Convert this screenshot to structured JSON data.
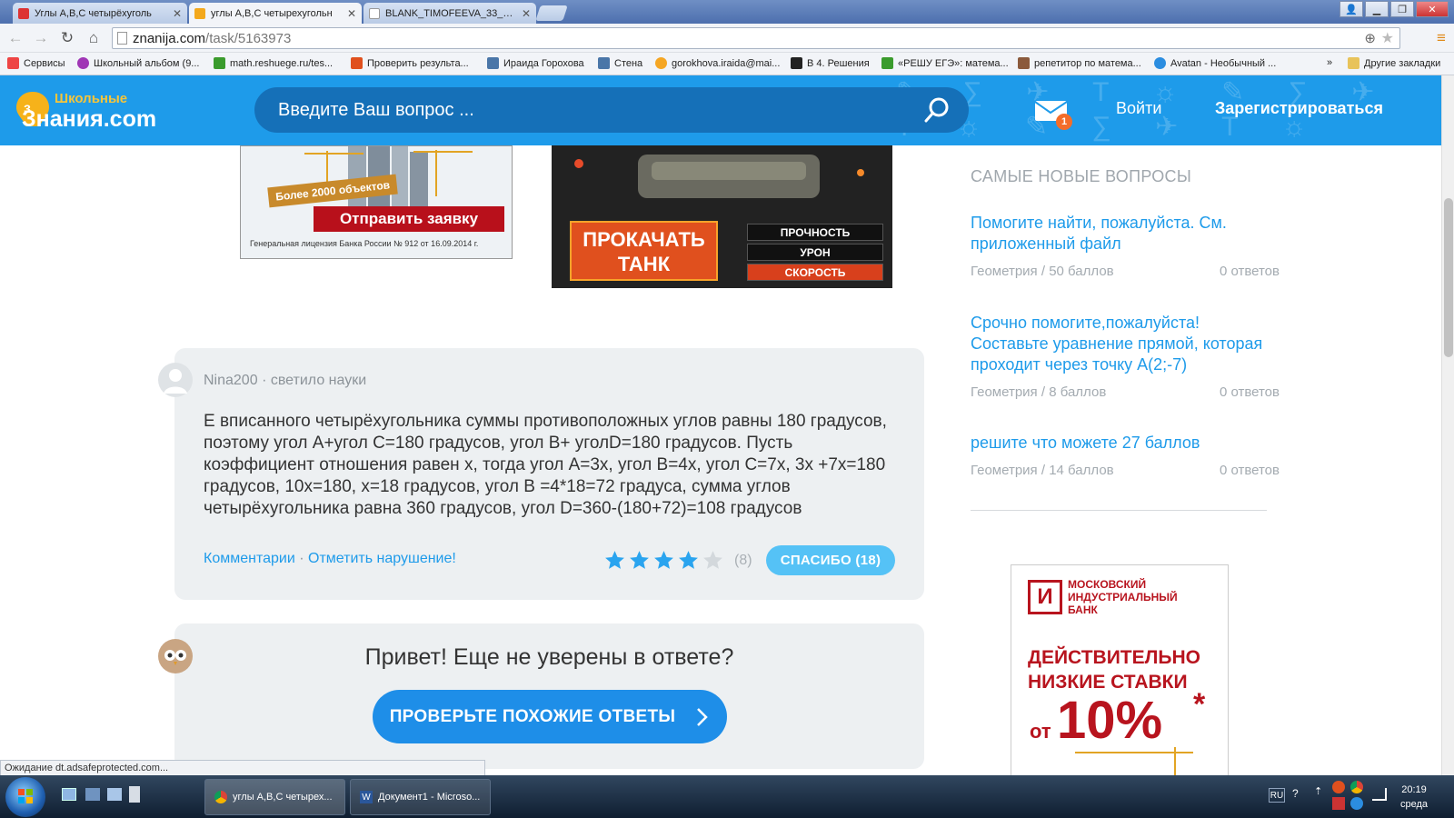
{
  "browser": {
    "tabs": [
      {
        "label": "Углы A,B,C четырёхуголь",
        "color": "#d33",
        "active": false
      },
      {
        "label": "углы А,В,С четырехугольн",
        "color": "#f3a81c",
        "active": true
      },
      {
        "label": "BLANK_TIMOFEEVA_33___3",
        "color": "#888",
        "active": false
      }
    ],
    "url_host": "znanija.com",
    "url_path": "/task/5163973",
    "bookmarks": [
      {
        "label": "Сервисы",
        "color": "#e44"
      },
      {
        "label": "Школьный альбом (9...",
        "color": "#a036b5"
      },
      {
        "label": "math.reshuege.ru/tes...",
        "color": "#3a9b2d"
      },
      {
        "label": "Проверить результа...",
        "color": "#e0501e"
      },
      {
        "label": "Ираида Горохова",
        "color": "#4a76a8"
      },
      {
        "label": "Стена",
        "color": "#4a76a8"
      },
      {
        "label": "gorokhova.iraida@mai...",
        "color": "#f5a623"
      },
      {
        "label": "В 4. Решения",
        "color": "#222"
      },
      {
        "label": "«РЕШУ ЕГЭ»: матема...",
        "color": "#3a9b2d"
      },
      {
        "label": "репетитор по матема...",
        "color": "#8b5a3c"
      },
      {
        "label": "Avatan - Необычный ...",
        "color": "#2b8de0"
      }
    ],
    "bookmarks_more": "»",
    "other_bookmarks": "Другие закладки",
    "status_text": "Ожидание dt.adsafeprotected.com..."
  },
  "site": {
    "logo_top": "Школьные",
    "logo_main": "Знания.com",
    "search_placeholder": "Введите Ваш вопрос ...",
    "mail_badge": "1",
    "login": "Войти",
    "register": "Зарегистрироваться"
  },
  "ads": {
    "a1_badge": "Более 2000 объектов",
    "a1_button": "Отправить заявку",
    "a1_license": "Генеральная лицензия Банка России № 912 от 16.09.2014 г.",
    "a2_button_line1": "ПРОКАЧАТЬ",
    "a2_button_line2": "ТАНК",
    "a2_stat1": "ПРОЧНОСТЬ",
    "a2_stat2": "УРОН",
    "a2_stat3": "СКОРОСТЬ",
    "a3_bank_line1": "МОСКОВСКИЙ",
    "a3_bank_line2": "ИНДУСТРИАЛЬНЫЙ",
    "a3_bank_line3": "БАНК",
    "a3_headline_line1": "ДЕЙСТВИТЕЛЬНО",
    "a3_headline_line2": "НИЗКИЕ СТАВКИ",
    "a3_from": "от",
    "a3_rate": "10%",
    "a3_asterisk": "*"
  },
  "answer": {
    "author": "Nina200",
    "rank": "светило науки",
    "text": "Е вписанного четырёхугольника суммы противоположных углов равны 180 градусов, поэтому угол А+угол С=180 градусов, угол В+ уголD=180 градусов. Пусть коэффициент отношения равен х, тогда угол А=3х, угол В=4х, угол С=7х, 3х +7х=180 градусов, 10х=180, х=18 градусов, угол В =4*18=72 градуса, сумма углов четырёхугольника равна 360 градусов, угол D=360-(180+72)=108 градусов",
    "comments": "Комментарии",
    "separator": "·",
    "report": "Отметить нарушение!",
    "rating": 4,
    "votes": "(8)",
    "thanks": "СПАСИБО (18)"
  },
  "helper": {
    "title": "Привет! Еще не уверены в ответе?",
    "button": "ПРОВЕРЬТЕ ПОХОЖИЕ ОТВЕТЫ"
  },
  "sidebar": {
    "title": "САМЫЕ НОВЫЕ ВОПРОСЫ",
    "questions": [
      {
        "title": "Помогите найти, пожалуйста. См. приложенный файл",
        "subject": "Геометрия",
        "points": "50 баллов",
        "answers": "0 ответов"
      },
      {
        "title": "Срочно помогите,пожалуйста! Составьте уравнение прямой, которая проходит через точку А(2;-7)",
        "subject": "Геометрия",
        "points": "8 баллов",
        "answers": "0 ответов"
      },
      {
        "title": "решите что можете 27 баллов",
        "subject": "Геометрия",
        "points": "14 баллов",
        "answers": "0 ответов"
      }
    ],
    "meta_sep": "/"
  },
  "taskbar": {
    "items": [
      {
        "label": "углы А,В,С четырех..."
      },
      {
        "label": "Документ1 - Microso..."
      }
    ],
    "lang": "RU",
    "time": "20:19",
    "day": "среда"
  }
}
